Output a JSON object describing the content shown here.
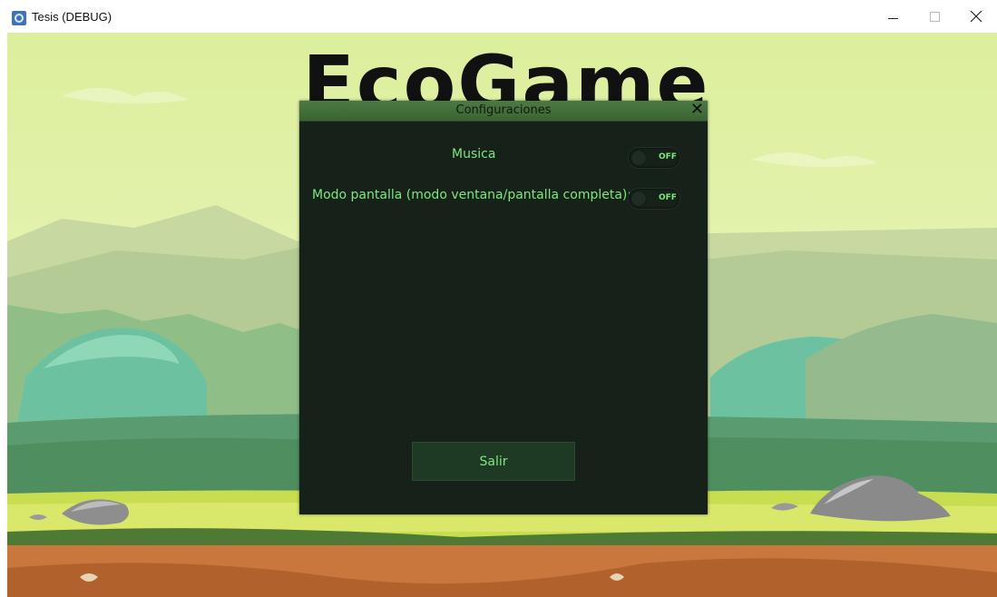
{
  "window": {
    "title": "Tesis (DEBUG)",
    "icon": "engine-app-icon",
    "controls": [
      "minimize-icon",
      "maximize-icon",
      "close-icon"
    ]
  },
  "game": {
    "logo_text": "EcoGame"
  },
  "dialog": {
    "title": "Configuraciones",
    "close_label": "✕",
    "music_label": "Musica",
    "music_toggle_state": "OFF",
    "screen_mode_label": "Modo pantalla (modo ventana/pantalla completa):",
    "screen_toggle_state": "OFF",
    "exit_button": "Salir"
  },
  "colors": {
    "dialog_bg": "#16211a",
    "header_green": "#4c7a43",
    "text_green": "#7ee87b",
    "button_bg": "#1e3a24"
  }
}
